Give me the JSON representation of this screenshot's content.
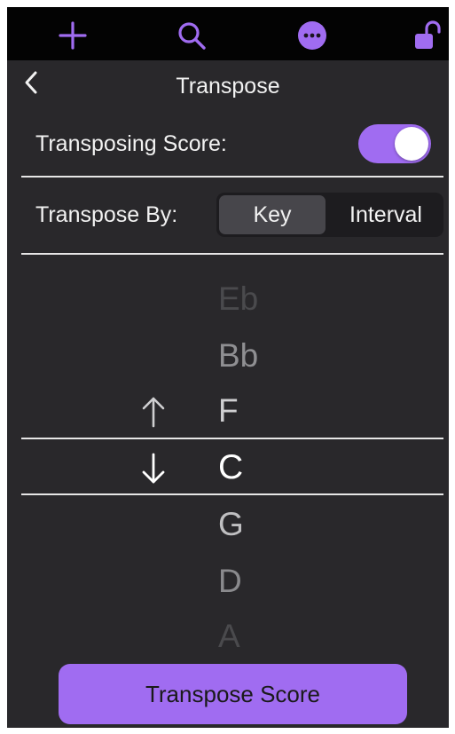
{
  "colors": {
    "accent": "#a06cf1",
    "toolbar_background": "#030303",
    "panel_background": "#29282b",
    "text": "#f2f2f2",
    "divider": "#e6e6e6"
  },
  "toolbar": {
    "icons": [
      "plus-icon",
      "search-icon",
      "more-icon",
      "unlock-icon"
    ]
  },
  "header": {
    "title": "Transpose",
    "back_icon": "chevron-left-icon"
  },
  "transposing_score": {
    "label": "Transposing Score:",
    "enabled": true
  },
  "transpose_by": {
    "label": "Transpose By:",
    "options": [
      "Key",
      "Interval"
    ],
    "selected": "Key"
  },
  "picker": {
    "items": [
      "Eb",
      "Bb",
      "F",
      "C",
      "G",
      "D",
      "A"
    ],
    "selected": "C",
    "up_arrow": "↑",
    "down_arrow": "↓"
  },
  "action": {
    "label": "Transpose Score"
  }
}
